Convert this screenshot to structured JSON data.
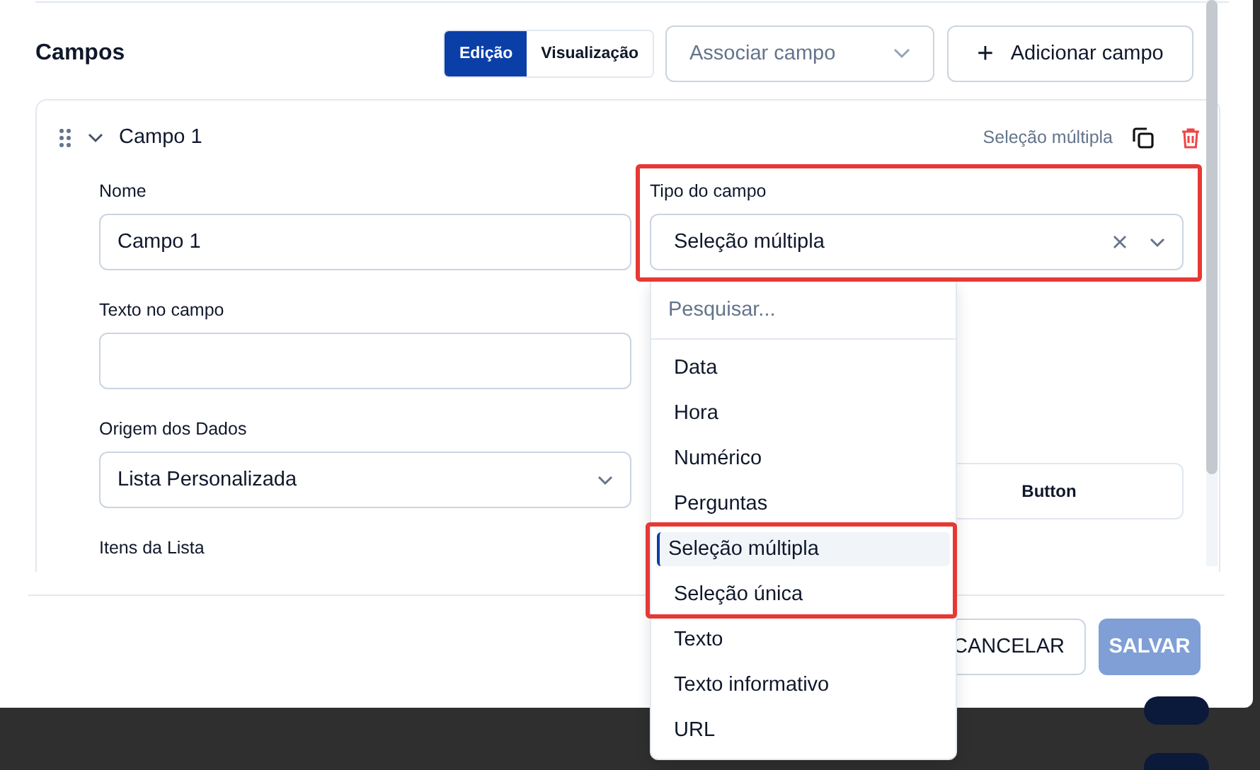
{
  "section_title": "Campos",
  "view_tabs": [
    {
      "label": "Edição",
      "selected": true
    },
    {
      "label": "Visualização",
      "selected": false
    }
  ],
  "associate_select": {
    "placeholder": "Associar campo"
  },
  "add_button": {
    "icon": "+",
    "label": "Adicionar campo"
  },
  "field_card": {
    "title": "Campo 1",
    "type_caption": "Seleção múltipla",
    "name_label": "Nome",
    "name_value": "Campo 1",
    "type_label": "Tipo do campo",
    "type_value": "Seleção múltipla",
    "hint_label": "Texto no campo",
    "source_label": "Origem dos Dados",
    "source_value": "Lista Personalizada",
    "side_button": "Button",
    "list_label": "Itens da Lista"
  },
  "type_dropdown": {
    "search_placeholder": "Pesquisar...",
    "options": [
      {
        "label": "Data",
        "selected": false
      },
      {
        "label": "Hora",
        "selected": false
      },
      {
        "label": "Numérico",
        "selected": false
      },
      {
        "label": "Perguntas",
        "selected": false
      },
      {
        "label": "Seleção múltipla",
        "selected": true
      },
      {
        "label": "Seleção única",
        "selected": false
      },
      {
        "label": "Texto",
        "selected": false
      },
      {
        "label": "Texto informativo",
        "selected": false
      },
      {
        "label": "URL",
        "selected": false
      }
    ]
  },
  "footer": {
    "cancel": "CANCELAR",
    "save": {
      "label": "SALVAR",
      "disabled": true
    }
  }
}
